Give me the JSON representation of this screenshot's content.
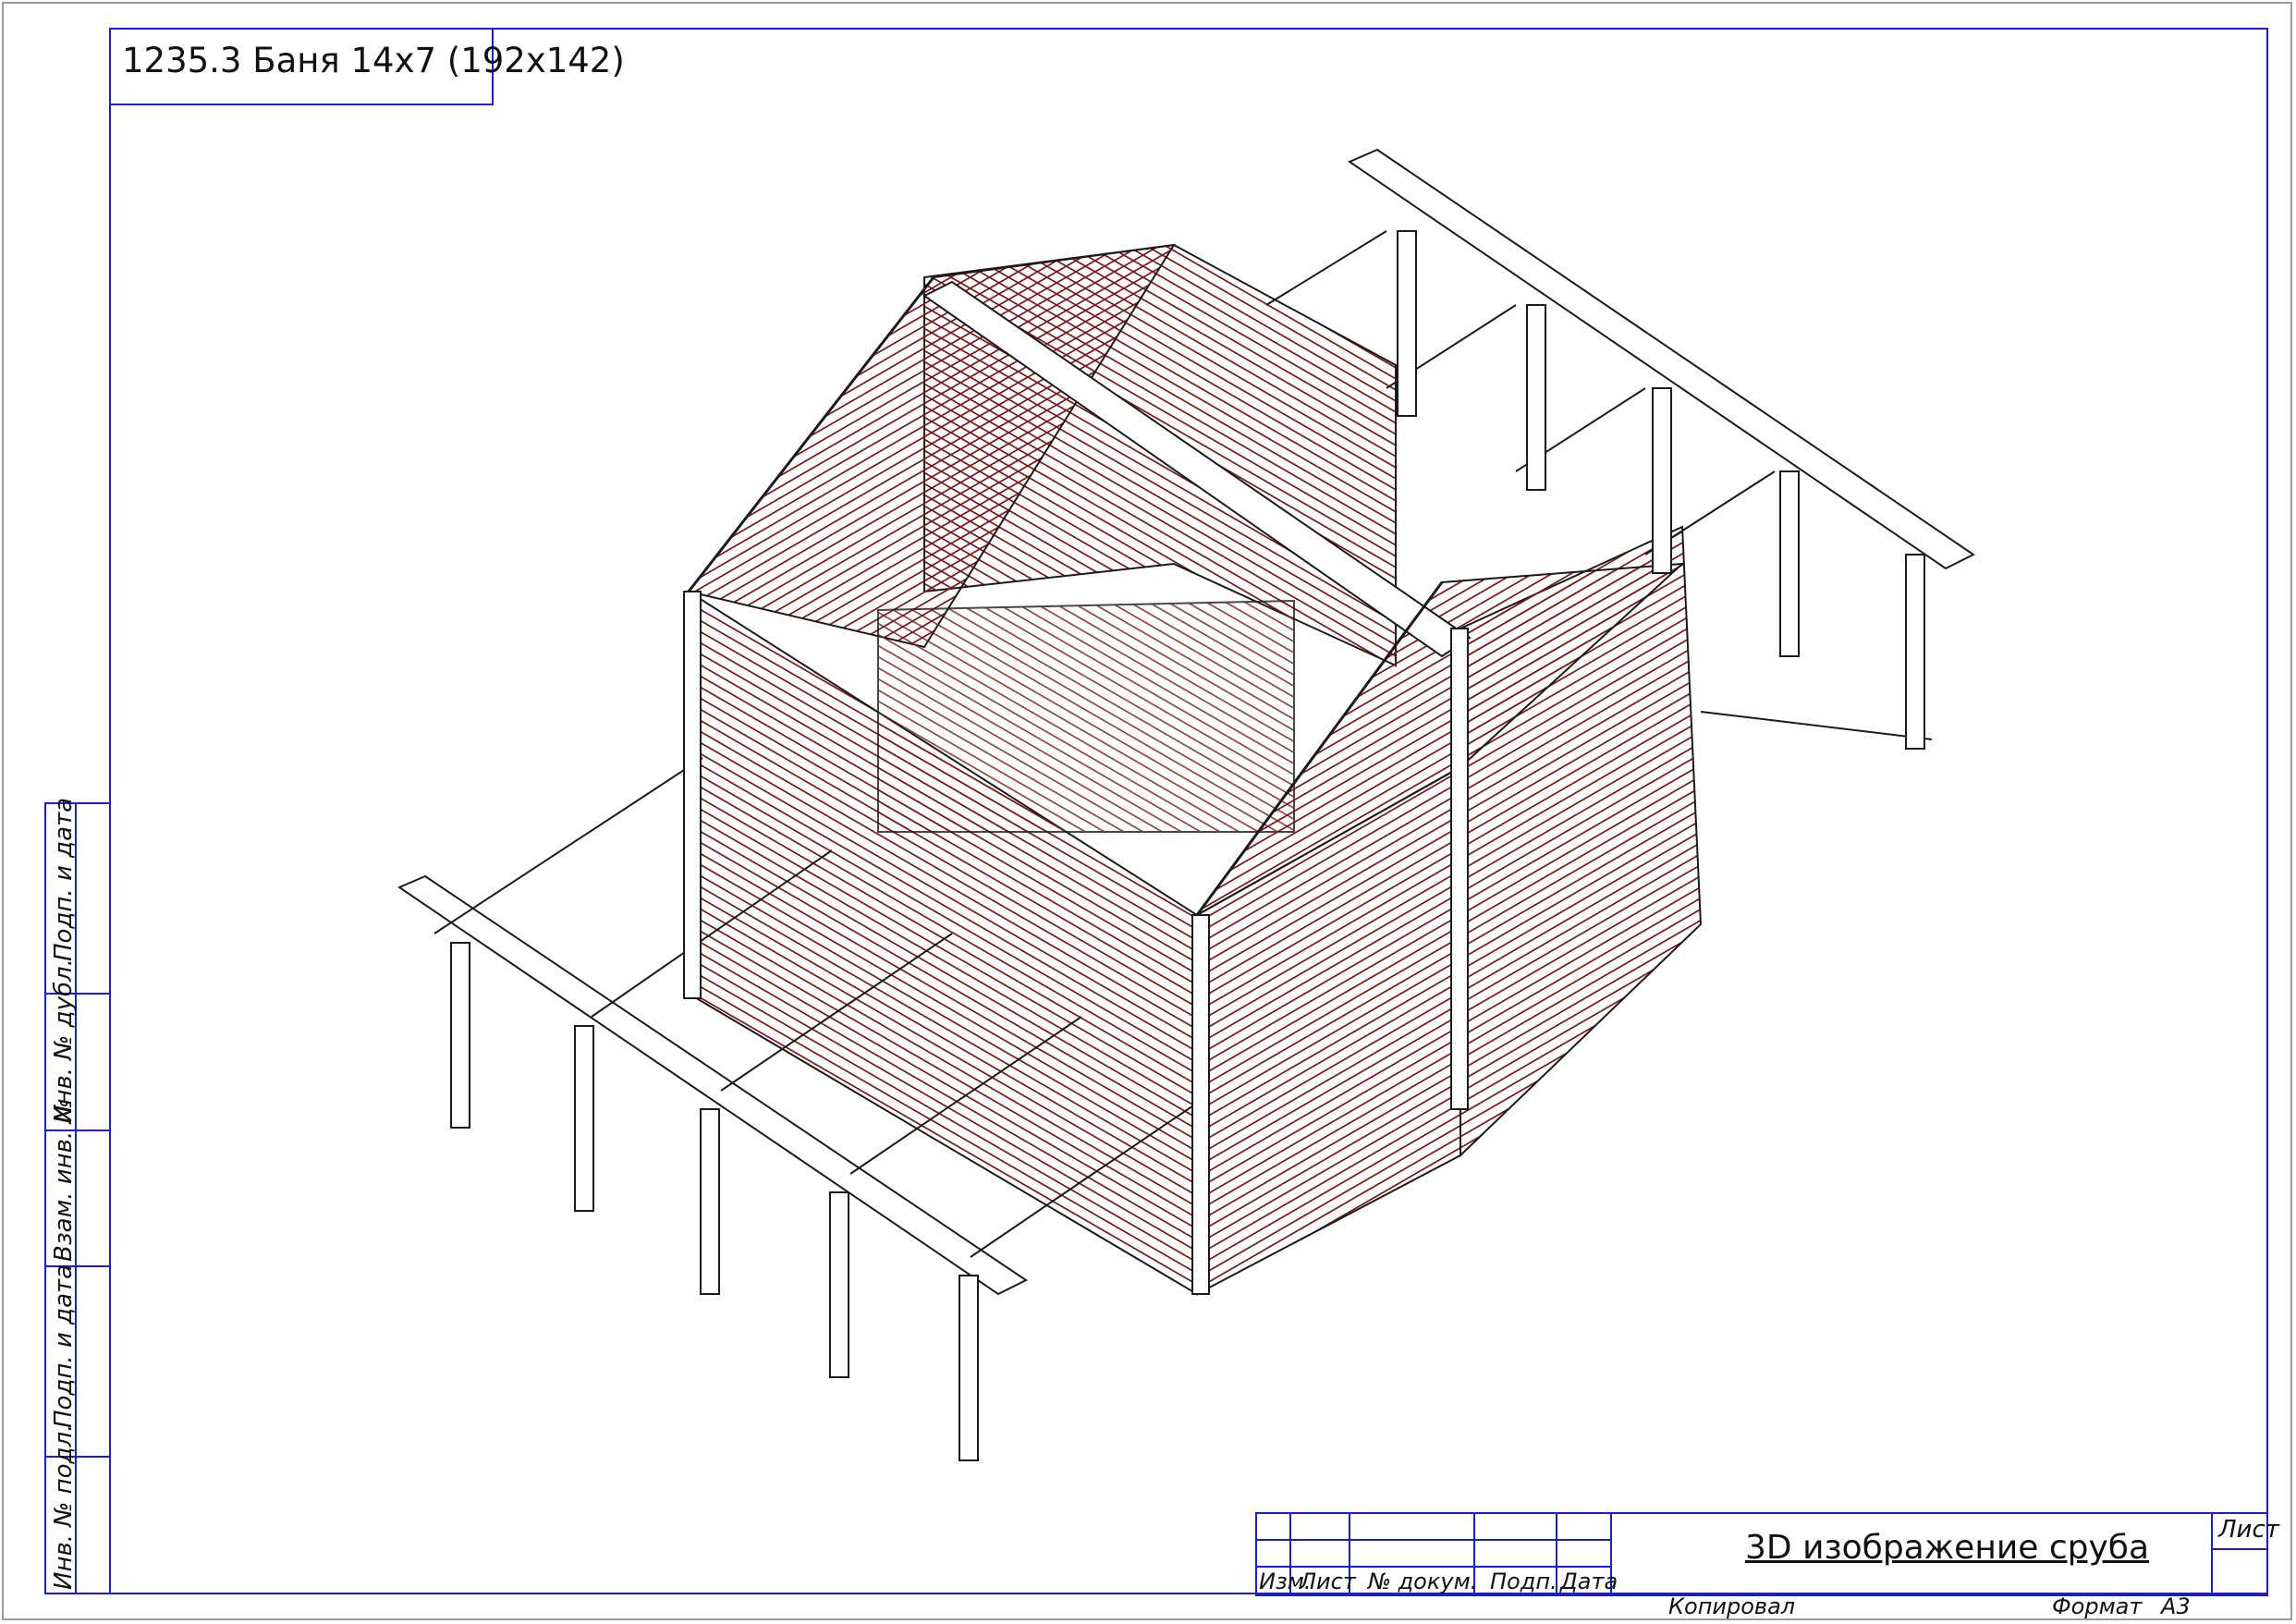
{
  "drawing_title": "1235.3 Баня 14x7 (192x142)",
  "caption": "3D изображение сруба",
  "side_labels": [
    "Подп. и дата",
    "Инв. № дубл.",
    "Взам. инв. №",
    "Подп. и дата",
    "Инв. № подл."
  ],
  "stamp": {
    "columns": [
      "Изм.",
      "Лист",
      "№ докум.",
      "Подп.",
      "Дата"
    ],
    "sheet_label": "Лист",
    "copied_label": "Копировал",
    "format_label": "Формат",
    "format_value": "A3"
  },
  "colors": {
    "frame": "#1d1dd6",
    "log_lines": "#7a1a1a",
    "outline": "#1a1a1a"
  }
}
